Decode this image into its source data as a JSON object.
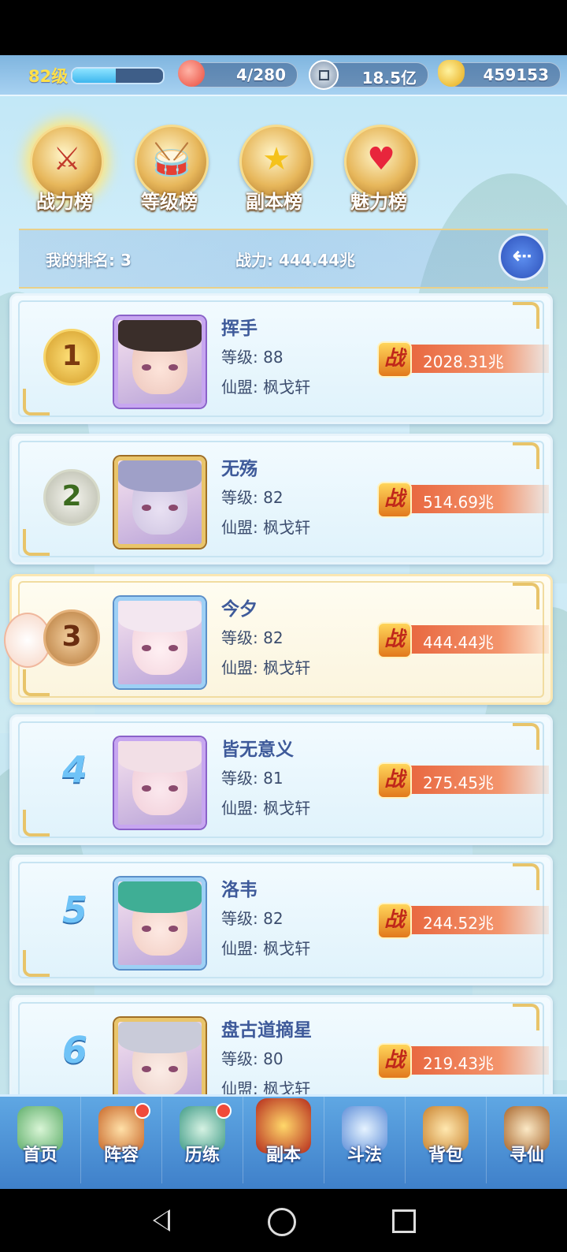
{
  "resources": {
    "level": "82级",
    "xp_fraction": 0.48,
    "stamina": "4/280",
    "silver": "18.5亿",
    "gold": "459153",
    "icons": [
      "peach-icon",
      "coin-icon",
      "gold-ingot-icon"
    ]
  },
  "tabs": [
    {
      "label": "战力榜",
      "glyph": "⚔",
      "active": true
    },
    {
      "label": "等级榜",
      "glyph": "🥁",
      "active": false
    },
    {
      "label": "副本榜",
      "glyph": "★",
      "active": false
    },
    {
      "label": "魅力榜",
      "glyph": "♥",
      "active": false
    }
  ],
  "my_rank": {
    "rank_text": "我的排名: 3",
    "power_text": "战力: 444.44兆",
    "back_icon": "back-arrow-icon"
  },
  "rankings": [
    {
      "rank": "1",
      "name": "挥手",
      "level": "等级: 88",
      "guild": "仙盟: 枫戈轩",
      "power": "2028.31兆",
      "power_badge": "战"
    },
    {
      "rank": "2",
      "name": "无殇",
      "level": "等级: 82",
      "guild": "仙盟: 枫戈轩",
      "power": "514.69兆",
      "power_badge": "战"
    },
    {
      "rank": "3",
      "name": "今夕",
      "level": "等级: 82",
      "guild": "仙盟: 枫戈轩",
      "power": "444.44兆",
      "power_badge": "战"
    },
    {
      "rank": "4",
      "name": "皆无意义",
      "level": "等级: 81",
      "guild": "仙盟: 枫戈轩",
      "power": "275.45兆",
      "power_badge": "战"
    },
    {
      "rank": "5",
      "name": "洛韦",
      "level": "等级: 82",
      "guild": "仙盟: 枫戈轩",
      "power": "244.52兆",
      "power_badge": "战"
    },
    {
      "rank": "6",
      "name": "盘古道摘星",
      "level": "等级: 80",
      "guild": "仙盟: 枫戈轩",
      "power": "219.43兆",
      "power_badge": "战"
    }
  ],
  "bottom_nav": [
    {
      "label": "首页",
      "badge": false
    },
    {
      "label": "阵容",
      "badge": true
    },
    {
      "label": "历练",
      "badge": true
    },
    {
      "label": "副本",
      "badge": false
    },
    {
      "label": "斗法",
      "badge": false
    },
    {
      "label": "背包",
      "badge": false
    },
    {
      "label": "寻仙",
      "badge": false
    }
  ]
}
